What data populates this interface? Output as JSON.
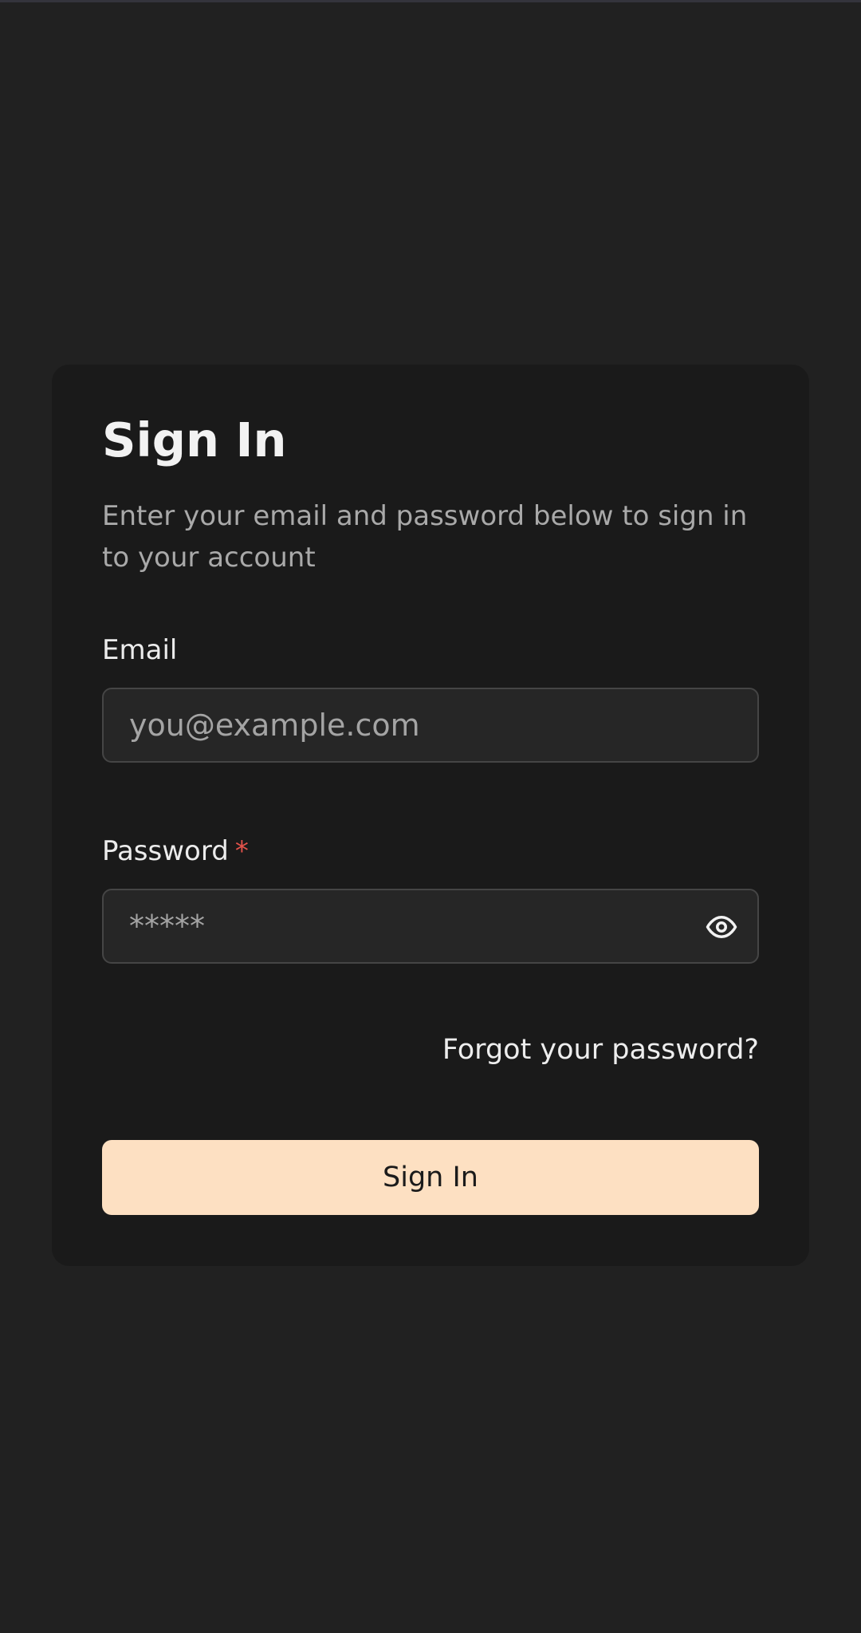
{
  "signin": {
    "title": "Sign In",
    "subtitle": "Enter your email and password below to sign in to your account",
    "email": {
      "label": "Email",
      "placeholder": "you@example.com",
      "value": ""
    },
    "password": {
      "label": "Password",
      "required_mark": "*",
      "placeholder": "*****",
      "value": "",
      "toggle_icon": "eye-icon"
    },
    "forgot_link": "Forgot your password?",
    "submit_label": "Sign In"
  },
  "colors": {
    "page_bg": "#212121",
    "card_bg": "#1a1a1a",
    "input_bg": "#262626",
    "button_bg": "#fde0c2",
    "required": "#e5534b"
  }
}
